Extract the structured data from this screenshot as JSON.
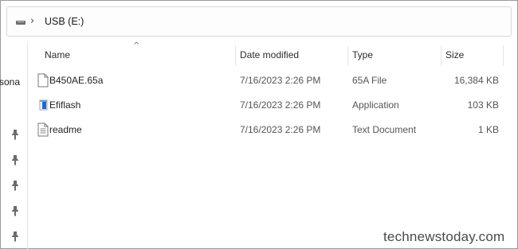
{
  "address": {
    "drive_icon": "drive-icon",
    "separator": "›",
    "location": "USB (E:)"
  },
  "nav": {
    "partial_label": "rsona",
    "pin_icon": "pin-icon"
  },
  "columns": {
    "sort_indicator": "^",
    "name": "Name",
    "date_modified": "Date modified",
    "type": "Type",
    "size": "Size"
  },
  "files": [
    {
      "name": "B450AE.65a",
      "date": "7/16/2023 2:26 PM",
      "type": "65A File",
      "size": "16,384 KB",
      "icon": "blank-file-icon"
    },
    {
      "name": "Efiflash",
      "date": "7/16/2023 2:26 PM",
      "type": "Application",
      "size": "103 KB",
      "icon": "application-icon"
    },
    {
      "name": "readme",
      "date": "7/16/2023 2:26 PM",
      "type": "Text Document",
      "size": "1 KB",
      "icon": "text-document-icon"
    }
  ],
  "watermark": "technewstoday.com",
  "colors": {
    "application_accent": "#1b6ac9",
    "border": "#9a9a9a"
  }
}
